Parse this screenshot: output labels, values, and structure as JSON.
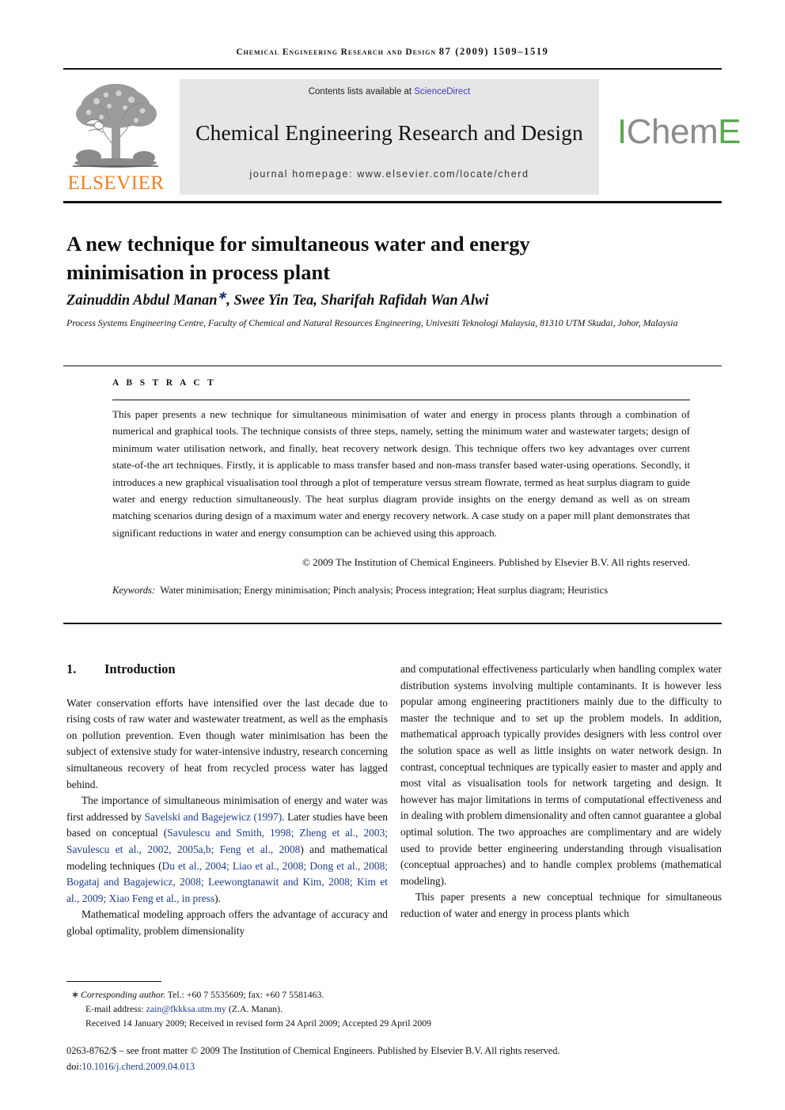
{
  "runhead": {
    "journal": "Chemical Engineering Research and Design",
    "volume_issue": "87 (2009) 1509–1519"
  },
  "masthead": {
    "elsevier_wordmark": "ELSEVIER",
    "contents_prefix": "Contents lists available at ",
    "contents_link": "ScienceDirect",
    "journal_title": "Chemical Engineering Research and Design",
    "homepage": "journal homepage: www.elsevier.com/locate/cherd",
    "icheme_i": "I",
    "icheme_chem": "Chem",
    "icheme_e": "E",
    "colors": {
      "elsevier_orange": "#f07f1a",
      "link_blue": "#3b3bbf",
      "icheme_green": "#5aa84f",
      "icheme_grey": "#8c8c8c",
      "band_grey": "#e6e6e6"
    }
  },
  "article": {
    "title": "A new technique for simultaneous water and energy minimisation in process plant",
    "authors": "Zainuddin Abdul Manan",
    "corresponding_marker": "∗",
    "authors_rest": ", Swee Yin Tea, Sharifah Rafidah Wan Alwi",
    "affiliation": "Process Systems Engineering Centre, Faculty of Chemical and Natural Resources Engineering, Univesiti Teknologi Malaysia, 81310 UTM Skudai, Johor, Malaysia"
  },
  "abstract": {
    "label": "A B S T R A C T",
    "body": "This paper presents a new technique for simultaneous minimisation of water and energy in process plants through a combination of numerical and graphical tools. The technique consists of three steps, namely, setting the minimum water and wastewater targets; design of minimum water utilisation network, and finally, heat recovery network design. This technique offers two key advantages over current state-of-the art techniques. Firstly, it is applicable to mass transfer based and non-mass transfer based water-using operations. Secondly, it introduces a new graphical visualisation tool through a plot of temperature versus stream flowrate, termed as heat surplus diagram to guide water and energy reduction simultaneously. The heat surplus diagram provide insights on the energy demand as well as on stream matching scenarios during design of a maximum water and energy recovery network. A case study on a paper mill plant demonstrates that significant reductions in water and energy consumption can be achieved using this approach.",
    "copyright": "© 2009 The Institution of Chemical Engineers. Published by Elsevier B.V. All rights reserved.",
    "keywords_label": "Keywords:",
    "keywords_value": "Water minimisation; Energy minimisation; Pinch analysis; Process integration; Heat surplus diagram; Heuristics"
  },
  "body": {
    "section_number": "1.",
    "section_title": "Introduction",
    "left": {
      "p1": "Water conservation efforts have intensified over the last decade due to rising costs of raw water and wastewater treatment, as well as the emphasis on pollution prevention. Even though water minimisation has been the subject of extensive study for water-intensive industry, research concerning simultaneous recovery of heat from recycled process water has lagged behind.",
      "p2_a": "The importance of simultaneous minimisation of energy and water was first addressed by ",
      "p2_cite1": "Savelski and Bagejewicz (1997)",
      "p2_b": ". Later studies have been based on conceptual (",
      "p2_cite2": "Savulescu and Smith, 1998; Zheng et al., 2003; Savulescu et al., 2002, 2005a,b; Feng et al., 2008",
      "p2_c": ") and mathematical modeling techniques (",
      "p2_cite3": "Du et al., 2004; Liao et al., 2008; Dong et al., 2008; Bogataj and Bagajewicz, 2008; Leewongtanawit and Kim, 2008; Kim et al., 2009; Xiao Feng et al., in press",
      "p2_d": ").",
      "p3": "Mathematical modeling approach offers the advantage of accuracy and global optimality, problem dimensionality"
    },
    "right": {
      "p1": "and computational effectiveness particularly when handling complex water distribution systems involving multiple contaminants. It is however less popular among engineering practitioners mainly due to the difficulty to master the technique and to set up the problem models. In addition, mathematical approach typically provides designers with less control over the solution space as well as little insights on water network design. In contrast, conceptual techniques are typically easier to master and apply and most vital as visualisation tools for network targeting and design. It however has major limitations in terms of computational effectiveness and in dealing with problem dimensionality and often cannot guarantee a global optimal solution. The two approaches are complimentary and are widely used to provide better engineering understanding through visualisation (conceptual approaches) and to handle complex problems (mathematical modeling).",
      "p2": "This paper presents a new conceptual technique for simultaneous reduction of water and energy in process plants which"
    }
  },
  "footnote": {
    "star": "∗",
    "corresponding_label": "Corresponding author.",
    "contact": " Tel.: +60 7 5535609; fax: +60 7 5581463.",
    "email_label": "E-mail address: ",
    "email": "zain@fkkksa.utm.my",
    "email_suffix": " (Z.A. Manan).",
    "dates": "Received 14 January 2009; Received in revised form 24 April 2009; Accepted 29 April 2009"
  },
  "imprint": {
    "line1": "0263-8762/$ – see front matter © 2009 The Institution of Chemical Engineers. Published by Elsevier B.V. All rights reserved.",
    "doi_prefix": "doi:",
    "doi": "10.1016/j.cherd.2009.04.013"
  }
}
